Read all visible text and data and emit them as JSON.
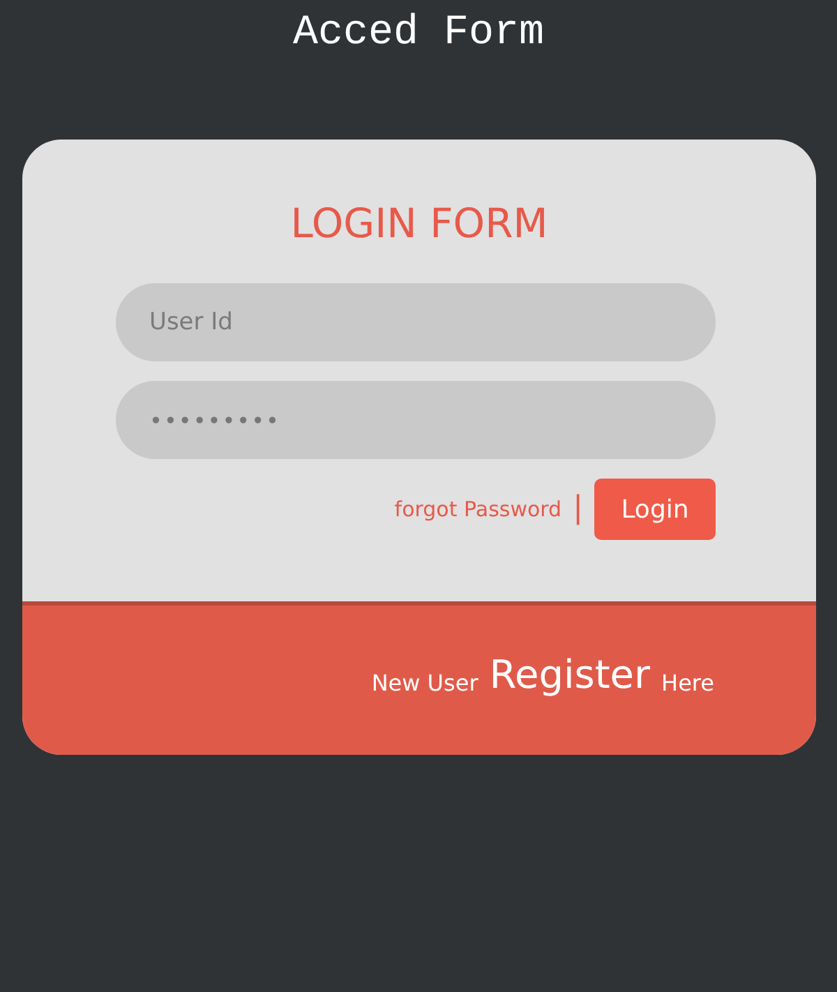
{
  "page_title": "Acced Form",
  "form": {
    "heading": "LOGIN FORM",
    "fields": [
      {
        "kind": "text",
        "placeholder": "User Id"
      },
      {
        "kind": "password",
        "value": "•••••••••"
      }
    ],
    "forgot_link": "forgot Password",
    "separator": "|",
    "login_button": "Login"
  },
  "footer": {
    "before": "New User",
    "link": "Register",
    "after": "Here"
  }
}
